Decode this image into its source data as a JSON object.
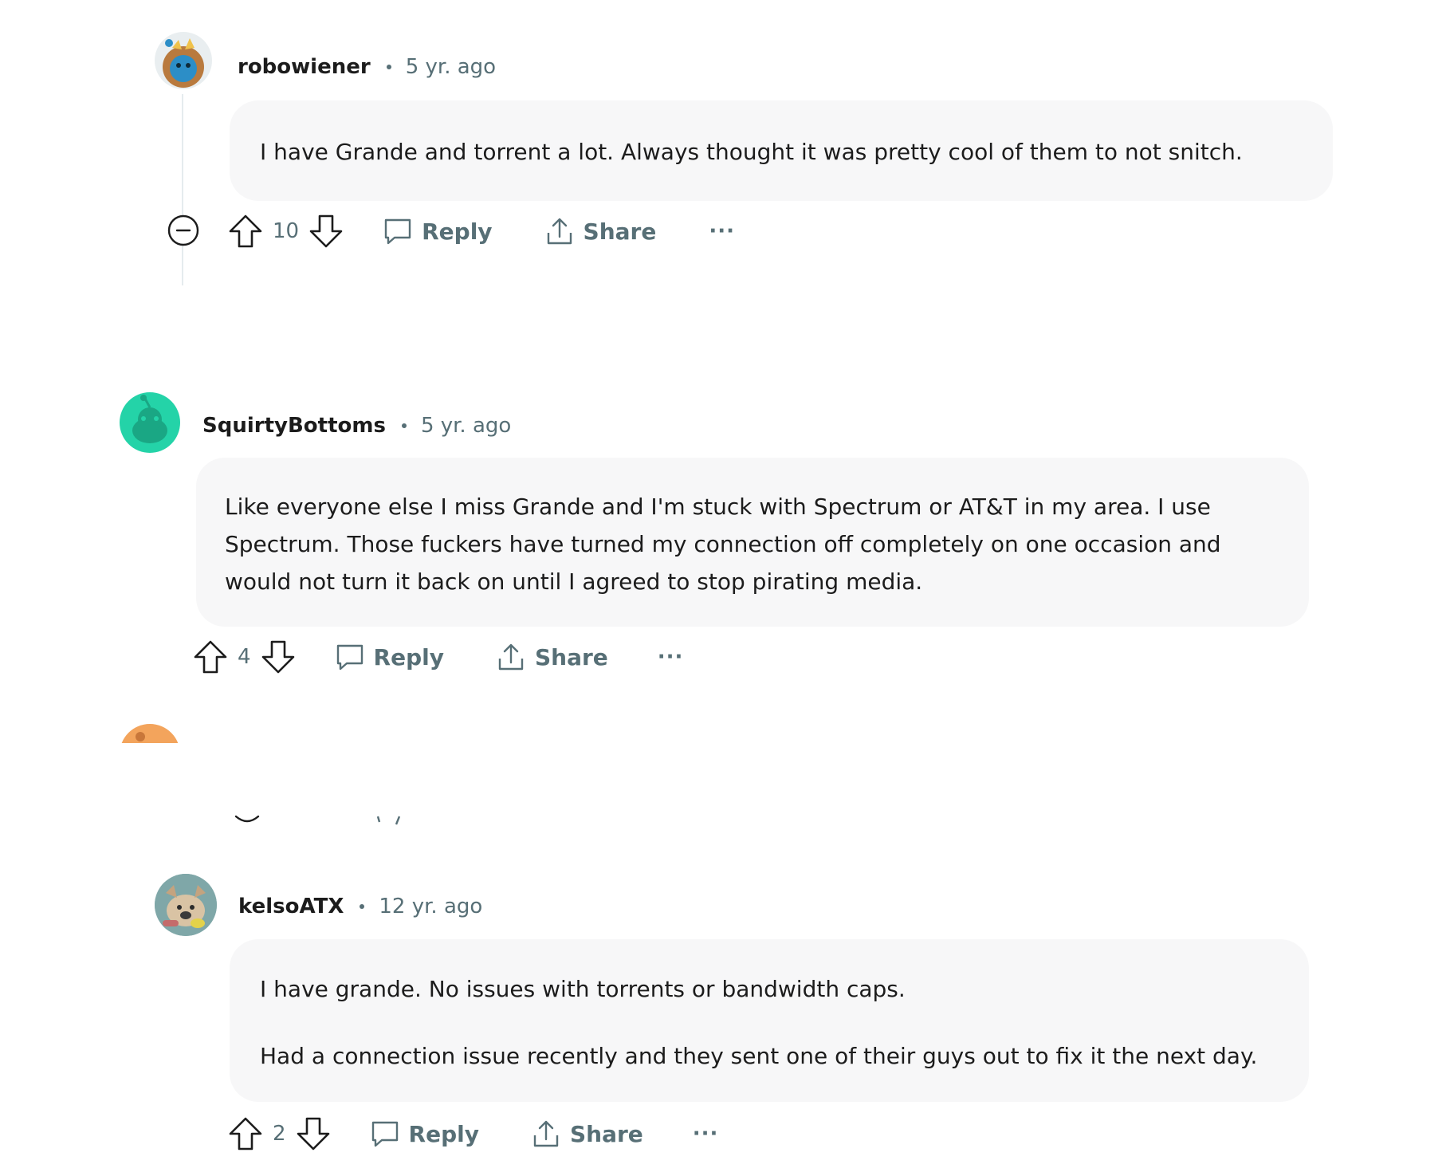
{
  "comments": [
    {
      "username": "robowiener",
      "time": "5 yr. ago",
      "body": [
        "I have Grande and torrent a lot. Always thought it was pretty cool of them to not snitch."
      ],
      "score": "10",
      "reply_label": "Reply",
      "share_label": "Share",
      "more_label": "···",
      "avatar_color": "#2c8ec7"
    },
    {
      "username": "SquirtyBottoms",
      "time": "5 yr. ago",
      "body": [
        "Like everyone else I miss Grande and I'm stuck with Spectrum or AT&T in my area. I use",
        "Spectrum. Those fuckers have turned my connection off completely on one occasion and",
        "would not turn it back on until I agreed to stop pirating media."
      ],
      "score": "4",
      "reply_label": "Reply",
      "share_label": "Share",
      "more_label": "···",
      "avatar_color": "#24d3a8"
    },
    {
      "username": "kelsoATX",
      "time": "12 yr. ago",
      "body": [
        "I have grande. No issues with torrents or bandwidth caps.",
        "Had a connection issue recently and they sent one of their guys out to fix it the next day."
      ],
      "score": "2",
      "reply_label": "Reply",
      "share_label": "Share",
      "more_label": "···",
      "avatar_color": "#7fa7a8"
    }
  ],
  "colors": {
    "meta_gray": "#576f76",
    "bubble_bg": "#f7f7f8",
    "text": "#1c1c1c",
    "peek_avatar": "#f3a45c"
  }
}
